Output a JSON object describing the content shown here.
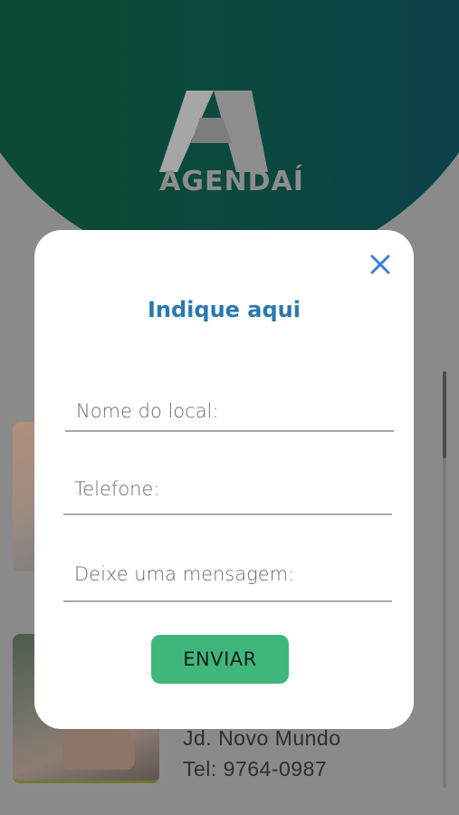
{
  "app": {
    "logo_text": "AGENDAÍ",
    "listing": {
      "address": "Jd. Novo Mundo",
      "phone": "Tel: 9764-0987"
    }
  },
  "modal": {
    "title": "Indique aqui",
    "close_icon": "close-icon",
    "fields": {
      "name_placeholder": "Nome do local:",
      "phone_placeholder": "Telefone:",
      "message_placeholder": "Deixe uma mensagem:"
    },
    "submit_label": "ENVIAR"
  },
  "colors": {
    "header_green": "#0c4a31",
    "header_teal": "#0b3f4c",
    "title_blue": "#2a78b0",
    "close_blue": "#3b7ddb",
    "button_green": "#3fb77c"
  }
}
